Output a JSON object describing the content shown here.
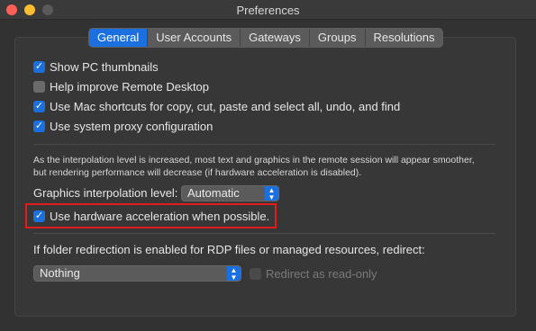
{
  "window": {
    "title": "Preferences"
  },
  "tabs": [
    {
      "label": "General",
      "active": true
    },
    {
      "label": "User Accounts",
      "active": false
    },
    {
      "label": "Gateways",
      "active": false
    },
    {
      "label": "Groups",
      "active": false
    },
    {
      "label": "Resolutions",
      "active": false
    }
  ],
  "options": {
    "show_thumbnails": {
      "label": "Show PC thumbnails",
      "checked": true
    },
    "help_improve": {
      "label": "Help improve Remote Desktop",
      "checked": false
    },
    "mac_shortcuts": {
      "label": "Use Mac shortcuts for copy, cut, paste and select all, undo, and find",
      "checked": true
    },
    "system_proxy": {
      "label": "Use system proxy configuration",
      "checked": true
    }
  },
  "interpolation": {
    "info_line1": "As the interpolation level is increased, most text and graphics in the remote session will appear smoother,",
    "info_line2": "but rendering performance will decrease (if hardware acceleration is disabled).",
    "label": "Graphics interpolation level:",
    "value": "Automatic"
  },
  "hardware_acceleration": {
    "label": "Use hardware acceleration when possible.",
    "checked": true
  },
  "folder_redirection": {
    "label": "If folder redirection is enabled for RDP files or managed resources, redirect:",
    "value": "Nothing",
    "read_only_label": "Redirect as read-only",
    "read_only_checked": false
  },
  "colors": {
    "accent": "#1b6fde",
    "highlight_box": "#e21c1c"
  }
}
